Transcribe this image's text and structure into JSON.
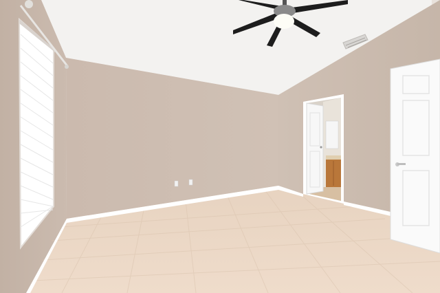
{
  "scene": {
    "description_visible_text": "",
    "colors": {
      "ceiling": "#f4f3f1",
      "wall_left": "#c9b9ad",
      "wall_back": "#cdbdb1",
      "wall_right": "#cbbbae",
      "floor": "#ead5c1",
      "baseboard": "#ffffff",
      "door": "#fafafa",
      "cabinet": "#b9773a",
      "fan_blade": "#1d1d1d",
      "window_glass": "#ffffff"
    },
    "objects": [
      "ceiling-fan",
      "air-vent",
      "window-with-blinds",
      "curtain-rod",
      "bathroom-doorway",
      "open-door",
      "electrical-outlets",
      "tile-floor"
    ]
  }
}
